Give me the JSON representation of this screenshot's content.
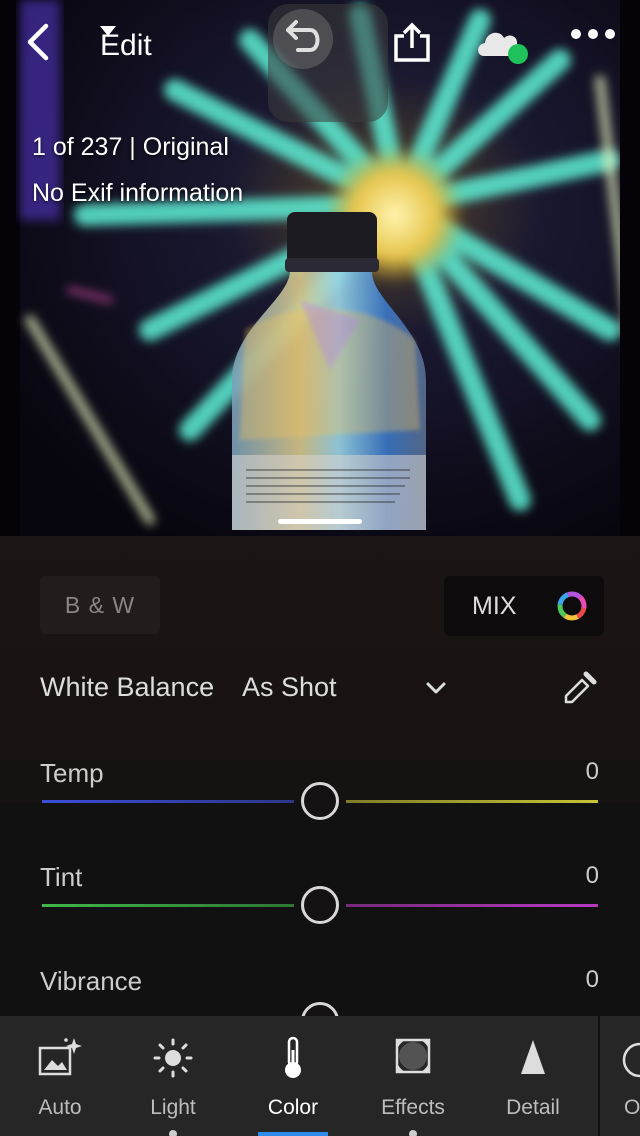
{
  "header": {
    "edit_label": "Edit",
    "icons": [
      "back-icon",
      "undo-icon",
      "share-icon",
      "cloud-sync-icon",
      "more-icon"
    ],
    "sync_status_color": "#1fc25a"
  },
  "photo": {
    "counter": "1 of 237 | Original",
    "exif": "No Exif information"
  },
  "panel": {
    "bw_label": "B & W",
    "mix_label": "MIX",
    "white_balance": {
      "label": "White Balance",
      "value": "As Shot"
    },
    "sliders": [
      {
        "label": "Temp",
        "value": "0",
        "level": 0.5,
        "colors": [
          "#3b4ed8",
          "#c6c436"
        ]
      },
      {
        "label": "Tint",
        "value": "0",
        "level": 0.5,
        "colors": [
          "#3fb84a",
          "#b83ac2"
        ]
      },
      {
        "label": "Vibrance",
        "value": "0",
        "level": 0.5
      }
    ]
  },
  "toolbar": {
    "items": [
      {
        "label": "Auto",
        "icon": "auto-icon"
      },
      {
        "label": "Light",
        "icon": "light-icon"
      },
      {
        "label": "Color",
        "icon": "color-icon",
        "active": true
      },
      {
        "label": "Effects",
        "icon": "effects-icon"
      },
      {
        "label": "Detail",
        "icon": "detail-icon"
      },
      {
        "label": "O",
        "icon": "optics-icon"
      }
    ],
    "accent": "#2d8ceb"
  }
}
